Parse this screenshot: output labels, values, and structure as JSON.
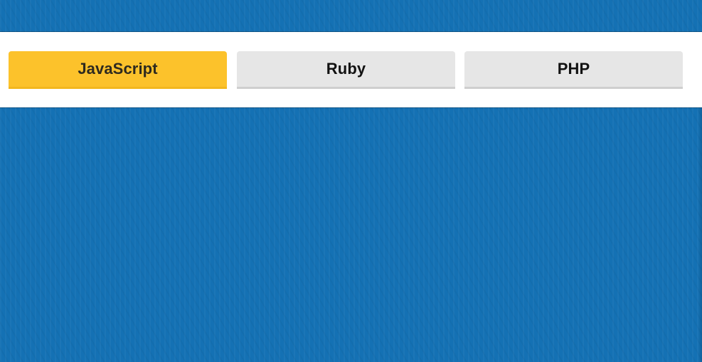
{
  "tabs": [
    {
      "label": "JavaScript",
      "active": true
    },
    {
      "label": "Ruby",
      "active": false
    },
    {
      "label": "PHP",
      "active": false
    }
  ],
  "colors": {
    "background": "#1471b4",
    "tab_bar": "#ffffff",
    "active_tab": "#fcc22b",
    "inactive_tab": "#e6e6e6"
  }
}
